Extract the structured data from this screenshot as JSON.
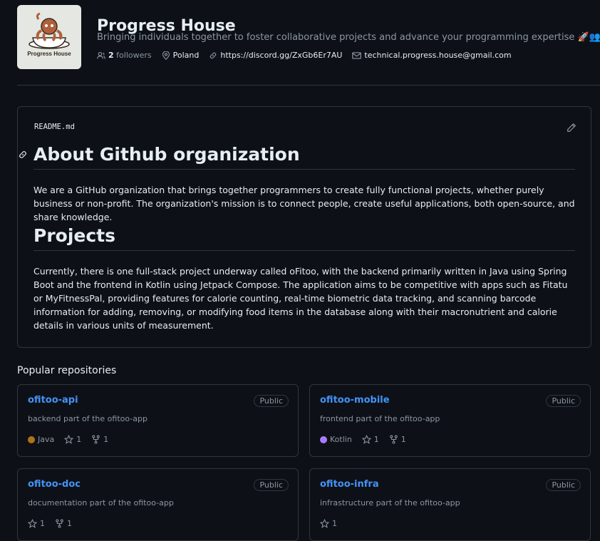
{
  "org": {
    "name": "Progress House",
    "description": "Bringing individuals together to foster collaborative projects and advance your programming expertise 🚀👥📈",
    "logo_text": "Progress House",
    "followers_count": "2",
    "followers_label": "followers",
    "location": "Poland",
    "link": "https://discord.gg/ZxGb6Er7AU",
    "email": "technical.progress.house@gmail.com"
  },
  "readme": {
    "filename": "README.md",
    "h1": "About Github organization",
    "p1": "We are a GitHub organization that brings together programmers to create fully functional projects, whether purely business or non-profit. The organization's mission is to connect people, create useful applications, both open-source, and share knowledge.",
    "h2": "Projects",
    "p2": "Currently, there is one full-stack project underway called oFitoo, with the backend primarily written in Java using Spring Boot and the frontend in Kotlin using Jetpack Compose. The application aims to be competitive with apps such as Fitatu or MyFitnessPal, providing features for calorie counting, real-time biometric data tracking, and scanning barcode information for adding, removing, or modifying food items in the database along with their macronutrient and calorie details in various units of measurement."
  },
  "popular": {
    "title": "Popular repositories",
    "repos": [
      {
        "name": "ofitoo-api",
        "visibility": "Public",
        "description": "backend part of the ofitoo-app",
        "language": "Java",
        "lang_color": "#b07219",
        "stars": "1",
        "forks": "1"
      },
      {
        "name": "ofitoo-mobile",
        "visibility": "Public",
        "description": "frontend part of the ofitoo-app",
        "language": "Kotlin",
        "lang_color": "#A97BFF",
        "stars": "1",
        "forks": "1"
      },
      {
        "name": "ofitoo-doc",
        "visibility": "Public",
        "description": "documentation part of the ofitoo-app",
        "stars": "1",
        "forks": "1"
      },
      {
        "name": "ofitoo-infra",
        "visibility": "Public",
        "description": "infrastructure part of the ofitoo-app",
        "stars": "1"
      }
    ]
  },
  "colors": {
    "accent": "#4493f8",
    "background": "#0d1117",
    "border": "#30363d",
    "muted": "#8d96a0"
  }
}
